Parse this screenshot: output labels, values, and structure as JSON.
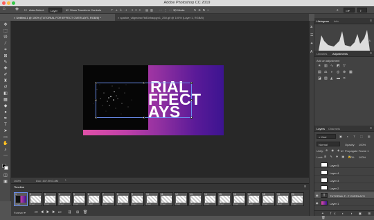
{
  "window": {
    "title": "Adobe Photoshop CC 2019"
  },
  "options_bar": {
    "auto_select_label": "Auto-Select:",
    "auto_select_value": "Layer",
    "show_transform_label": "Show Transform Controls",
    "mode_label": "3D Mode:"
  },
  "tabs": [
    {
      "label": "Untitled-1 @ 100% (TUTORIAL FOR EFFECT OVERLAYS, RGB/8) *"
    },
    {
      "label": "sparkle_v8gmdnw7b83nhaqqyx1_250.gif @ 100% (Layer 1, RGB/8)"
    }
  ],
  "artwork": {
    "line1": "RIAL",
    "line2": "FFECT",
    "line3": "AYS"
  },
  "status": {
    "zoom": "100%",
    "doc": "Doc: 437.9K/3.8M"
  },
  "timeline": {
    "title": "Timeline",
    "loop": "Forever",
    "frames": [
      {
        "num": "1",
        "delay": "0 sec"
      },
      {
        "num": "2",
        "delay": "0 sec"
      },
      {
        "num": "3",
        "delay": "0 sec"
      },
      {
        "num": "4",
        "delay": "0 sec"
      },
      {
        "num": "5",
        "delay": "0 sec"
      },
      {
        "num": "6",
        "delay": "0 sec"
      },
      {
        "num": "7",
        "delay": "0 sec"
      },
      {
        "num": "8",
        "delay": "0 sec"
      },
      {
        "num": "9",
        "delay": "0 sec"
      },
      {
        "num": "10",
        "delay": "0 sec"
      },
      {
        "num": "11",
        "delay": "0 sec"
      },
      {
        "num": "12",
        "delay": "0 sec"
      },
      {
        "num": "13",
        "delay": "0 sec"
      },
      {
        "num": "14",
        "delay": "0 sec"
      },
      {
        "num": "15",
        "delay": "0 sec"
      },
      {
        "num": "16",
        "delay": "0 sec"
      },
      {
        "num": "17",
        "delay": "0 sec"
      },
      {
        "num": "18",
        "delay": "0 sec"
      },
      {
        "num": "19",
        "delay": "0 sec"
      },
      {
        "num": "20",
        "delay": "0 sec"
      }
    ]
  },
  "histogram": {
    "tabs": [
      "Histogram",
      "Info"
    ]
  },
  "adjustments": {
    "tabs": [
      "Libraries",
      "Adjustments"
    ],
    "add_label": "Add an adjustment"
  },
  "layers_panel": {
    "tabs": [
      "Layers",
      "Channels"
    ],
    "filter_label": "Kind",
    "blend_mode": "Normal",
    "opacity_label": "Opacity:",
    "opacity_value": "100%",
    "unify_label": "Unify:",
    "propagate_label": "Propagate Frame 1",
    "lock_label": "Lock:",
    "fill_label": "Fill:",
    "fill_value": "100%",
    "layers": [
      {
        "name": "Layer 5"
      },
      {
        "name": "Layer 4"
      },
      {
        "name": "Layer 3"
      },
      {
        "name": "Layer 2"
      },
      {
        "name": "TUTORIAL F...T OVERLAYS"
      },
      {
        "name": "Layer 1"
      }
    ]
  },
  "colors": {
    "accent": "#6b8ff0",
    "gradient_start": "#e050a8",
    "gradient_end": "#3c1490"
  }
}
